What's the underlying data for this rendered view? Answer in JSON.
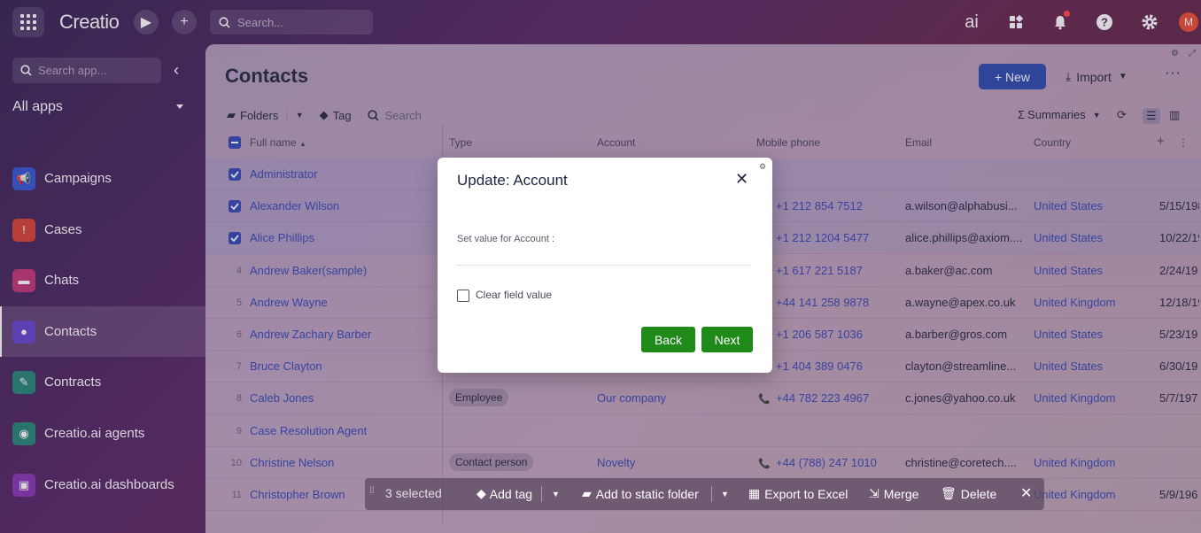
{
  "topbar": {
    "logo": "Creatio",
    "search_placeholder": "Search...",
    "ai_label": "ai",
    "avatar_initial": "M",
    "icons": [
      "apps-grid-icon",
      "play-icon",
      "plus-icon",
      "search-icon",
      "ai-icon",
      "grid-icon",
      "bell-icon",
      "help-icon",
      "gear-icon"
    ]
  },
  "sidebar": {
    "search_placeholder": "Search app...",
    "section_label": "All apps",
    "items": [
      {
        "label": "Campaigns",
        "color": "#3b5bd6",
        "icon": "megaphone-icon"
      },
      {
        "label": "Cases",
        "color": "#d64a3b",
        "icon": "case-icon"
      },
      {
        "label": "Chats",
        "color": "#c23b7a",
        "icon": "chat-icon"
      },
      {
        "label": "Contacts",
        "color": "#6a4bd0",
        "icon": "person-icon"
      },
      {
        "label": "Contracts",
        "color": "#2a8a7a",
        "icon": "contract-icon"
      },
      {
        "label": "Creatio.ai agents",
        "color": "#2a8a7a",
        "icon": "agent-icon"
      },
      {
        "label": "Creatio.ai dashboards",
        "color": "#8a3bb8",
        "icon": "dashboard-icon"
      }
    ]
  },
  "main": {
    "title": "Contacts",
    "new_label": "+ New",
    "import_label": "Import",
    "more_label": "···",
    "toolbar": {
      "folders": "Folders",
      "tag": "Tag",
      "search_placeholder": "Search",
      "summaries": "Summaries"
    },
    "columns": [
      "Full name",
      "Type",
      "Account",
      "Mobile phone",
      "Email",
      "Country"
    ],
    "rows": [
      {
        "num": "",
        "checked": true,
        "name": "Administrator",
        "type": "",
        "account": "",
        "phone": "",
        "email": "",
        "country": "",
        "date": ""
      },
      {
        "num": "",
        "checked": true,
        "name": "Alexander Wilson",
        "type": "",
        "account": "",
        "phone": "+1 212 854 7512",
        "email": "a.wilson@alphabusi...",
        "country": "United States",
        "date": "5/15/198"
      },
      {
        "num": "",
        "checked": true,
        "name": "Alice Phillips",
        "type": "",
        "account": "",
        "phone": "+1 212 1204 5477",
        "email": "alice.phillips@axiom....",
        "country": "United States",
        "date": "10/22/19"
      },
      {
        "num": "4",
        "checked": false,
        "name": "Andrew Baker(sample)",
        "type": "",
        "account": "",
        "phone": "+1 617 221 5187",
        "email": "a.baker@ac.com",
        "country": "United States",
        "date": "2/24/19"
      },
      {
        "num": "5",
        "checked": false,
        "name": "Andrew Wayne",
        "type": "",
        "account": "",
        "phone": "+44 141 258 9878",
        "email": "a.wayne@apex.co.uk",
        "country": "United Kingdom",
        "date": "12/18/19"
      },
      {
        "num": "6",
        "checked": false,
        "name": "Andrew Zachary Barber",
        "type": "",
        "account": "",
        "phone": "+1 206 587 1036",
        "email": "a.barber@gros.com",
        "country": "United States",
        "date": "5/23/19"
      },
      {
        "num": "7",
        "checked": false,
        "name": "Bruce Clayton",
        "type": "",
        "account": "",
        "phone": "+1 404 389 0476",
        "email": "clayton@streamline...",
        "country": "United States",
        "date": "6/30/19"
      },
      {
        "num": "8",
        "checked": false,
        "name": "Caleb Jones",
        "type": "Employee",
        "account": "Our company",
        "phone": "+44 782 223 4967",
        "email": "c.jones@yahoo.co.uk",
        "country": "United Kingdom",
        "date": "5/7/197"
      },
      {
        "num": "9",
        "checked": false,
        "name": "Case Resolution Agent",
        "type": "",
        "account": "",
        "phone": "",
        "email": "",
        "country": "",
        "date": ""
      },
      {
        "num": "10",
        "checked": false,
        "name": "Christine Nelson",
        "type": "Contact person",
        "account": "Novelty",
        "phone": "+44 (788) 247 1010",
        "email": "christine@coretech....",
        "country": "United Kingdom",
        "date": ""
      },
      {
        "num": "11",
        "checked": false,
        "name": "Christopher Brown",
        "type": "",
        "account": "",
        "phone": "",
        "email": "",
        "country": "United Kingdom",
        "date": "5/9/196"
      }
    ]
  },
  "bulkbar": {
    "selected": "3 selected",
    "add_tag": "Add tag",
    "add_static": "Add to static folder",
    "export": "Export to Excel",
    "merge": "Merge",
    "delete": "Delete"
  },
  "modal": {
    "title": "Update: Account",
    "field_label": "Set value for Account :",
    "checkbox_label": "Clear field value",
    "back_label": "Back",
    "next_label": "Next"
  }
}
